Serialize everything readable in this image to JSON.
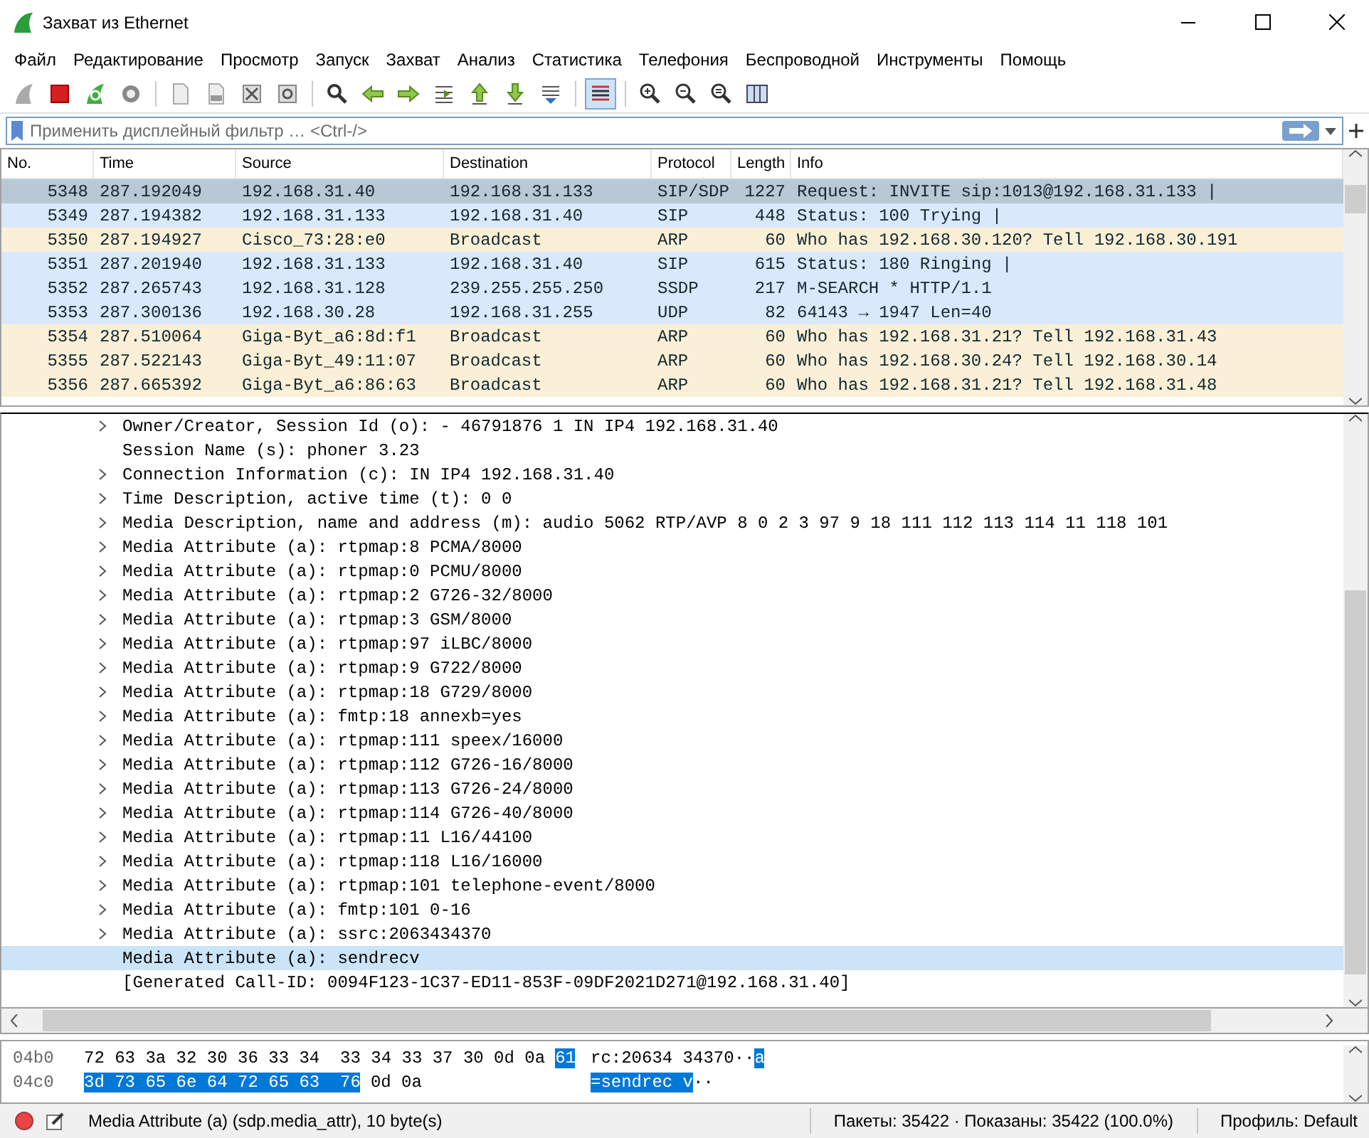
{
  "window": {
    "title": "Захват из Ethernet"
  },
  "menu": [
    "Файл",
    "Редактирование",
    "Просмотр",
    "Запуск",
    "Захват",
    "Анализ",
    "Статистика",
    "Телефония",
    "Беспроводной",
    "Инструменты",
    "Помощь"
  ],
  "toolbar": {
    "colorize_pressed": true
  },
  "filter": {
    "placeholder": "Применить дисплейный фильтр … <Ctrl-/>"
  },
  "packet_list": {
    "columns": [
      "No.",
      "Time",
      "Source",
      "Destination",
      "Protocol",
      "Length",
      "Info"
    ],
    "rows": [
      {
        "cells": [
          "5348",
          "287.192049",
          "192.168.31.40",
          "192.168.31.133",
          "SIP/SDP",
          "1227",
          "Request: INVITE sip:1013@192.168.31.133 |"
        ],
        "selected": true
      },
      {
        "cells": [
          "5349",
          "287.194382",
          "192.168.31.133",
          "192.168.31.40",
          "SIP",
          "448",
          "Status: 100 Trying |"
        ],
        "color": "#dae8fb",
        "selected": false
      },
      {
        "cells": [
          "5350",
          "287.194927",
          "Cisco_73:28:e0",
          "Broadcast",
          "ARP",
          "60",
          "Who has 192.168.30.120? Tell 192.168.30.191"
        ],
        "color": "#faf0d7",
        "selected": false
      },
      {
        "cells": [
          "5351",
          "287.201940",
          "192.168.31.133",
          "192.168.31.40",
          "SIP",
          "615",
          "Status: 180 Ringing |"
        ],
        "color": "#dae8fb",
        "selected": false
      },
      {
        "cells": [
          "5352",
          "287.265743",
          "192.168.31.128",
          "239.255.255.250",
          "SSDP",
          "217",
          "M-SEARCH * HTTP/1.1"
        ],
        "color": "#dae8fb",
        "selected": false
      },
      {
        "cells": [
          "5353",
          "287.300136",
          "192.168.30.28",
          "192.168.31.255",
          "UDP",
          "82",
          "64143 → 1947 Len=40"
        ],
        "color": "#dae8fb",
        "selected": false
      },
      {
        "cells": [
          "5354",
          "287.510064",
          "Giga-Byt_a6:8d:f1",
          "Broadcast",
          "ARP",
          "60",
          "Who has 192.168.31.21? Tell 192.168.31.43"
        ],
        "color": "#faf0d7",
        "selected": false
      },
      {
        "cells": [
          "5355",
          "287.522143",
          "Giga-Byt_49:11:07",
          "Broadcast",
          "ARP",
          "60",
          "Who has 192.168.30.24? Tell 192.168.30.14"
        ],
        "color": "#faf0d7",
        "selected": false
      },
      {
        "cells": [
          "5356",
          "287.665392",
          "Giga-Byt_a6:86:63",
          "Broadcast",
          "ARP",
          "60",
          "Who has 192.168.31.21? Tell 192.168.31.48"
        ],
        "color": "#faf0d7",
        "selected": false
      }
    ]
  },
  "details": [
    {
      "text": "Owner/Creator, Session Id (o): - 46791876 1 IN IP4 192.168.31.40",
      "expandable": true,
      "selected": false
    },
    {
      "text": "Session Name (s): phoner 3.23",
      "expandable": false,
      "selected": false
    },
    {
      "text": "Connection Information (c): IN IP4 192.168.31.40",
      "expandable": true,
      "selected": false
    },
    {
      "text": "Time Description, active time (t): 0 0",
      "expandable": true,
      "selected": false
    },
    {
      "text": "Media Description, name and address (m): audio 5062 RTP/AVP 8 0 2 3 97 9 18 111 112 113 114 11 118 101",
      "expandable": true,
      "selected": false
    },
    {
      "text": "Media Attribute (a): rtpmap:8 PCMA/8000",
      "expandable": true,
      "selected": false
    },
    {
      "text": "Media Attribute (a): rtpmap:0 PCMU/8000",
      "expandable": true,
      "selected": false
    },
    {
      "text": "Media Attribute (a): rtpmap:2 G726-32/8000",
      "expandable": true,
      "selected": false
    },
    {
      "text": "Media Attribute (a): rtpmap:3 GSM/8000",
      "expandable": true,
      "selected": false
    },
    {
      "text": "Media Attribute (a): rtpmap:97 iLBC/8000",
      "expandable": true,
      "selected": false
    },
    {
      "text": "Media Attribute (a): rtpmap:9 G722/8000",
      "expandable": true,
      "selected": false
    },
    {
      "text": "Media Attribute (a): rtpmap:18 G729/8000",
      "expandable": true,
      "selected": false
    },
    {
      "text": "Media Attribute (a): fmtp:18 annexb=yes",
      "expandable": true,
      "selected": false
    },
    {
      "text": "Media Attribute (a): rtpmap:111 speex/16000",
      "expandable": true,
      "selected": false
    },
    {
      "text": "Media Attribute (a): rtpmap:112 G726-16/8000",
      "expandable": true,
      "selected": false
    },
    {
      "text": "Media Attribute (a): rtpmap:113 G726-24/8000",
      "expandable": true,
      "selected": false
    },
    {
      "text": "Media Attribute (a): rtpmap:114 G726-40/8000",
      "expandable": true,
      "selected": false
    },
    {
      "text": "Media Attribute (a): rtpmap:11 L16/44100",
      "expandable": true,
      "selected": false
    },
    {
      "text": "Media Attribute (a): rtpmap:118 L16/16000",
      "expandable": true,
      "selected": false
    },
    {
      "text": "Media Attribute (a): rtpmap:101 telephone-event/8000",
      "expandable": true,
      "selected": false
    },
    {
      "text": "Media Attribute (a): fmtp:101 0-16",
      "expandable": true,
      "selected": false
    },
    {
      "text": "Media Attribute (a): ssrc:2063434370",
      "expandable": true,
      "selected": false
    },
    {
      "text": "Media Attribute (a): sendrecv",
      "expandable": false,
      "selected": true
    },
    {
      "text": "[Generated Call-ID: 0094F123-1C37-ED11-853F-09DF2021D271@192.168.31.40]",
      "expandable": false,
      "selected": false
    }
  ],
  "hex": [
    {
      "offset": "04b0",
      "bytes": [
        {
          "text": "72 63 3a 32 30 36 33 34  33 34 33 37 30 0d 0a",
          "selected": false
        },
        {
          "text": "61",
          "selected": true
        }
      ],
      "ascii": [
        {
          "text": "rc:20634 34370··",
          "selected": false
        },
        {
          "text": "a",
          "selected": true
        }
      ]
    },
    {
      "offset": "04c0",
      "bytes": [
        {
          "text": "3d 73 65 6e 64 72 65 63  76",
          "selected": true
        },
        {
          "text": "0d 0a",
          "selected": false
        }
      ],
      "ascii": [
        {
          "text": "=sendrec v",
          "selected": true
        },
        {
          "text": "··",
          "selected": false
        }
      ]
    }
  ],
  "status_bar": {
    "field": "Media Attribute (a) (sdp.media_attr), 10 byte(s)",
    "packets": "Пакеты: 35422 · Показаны: 35422 (100.0%)",
    "profile": "Профиль: Default"
  }
}
